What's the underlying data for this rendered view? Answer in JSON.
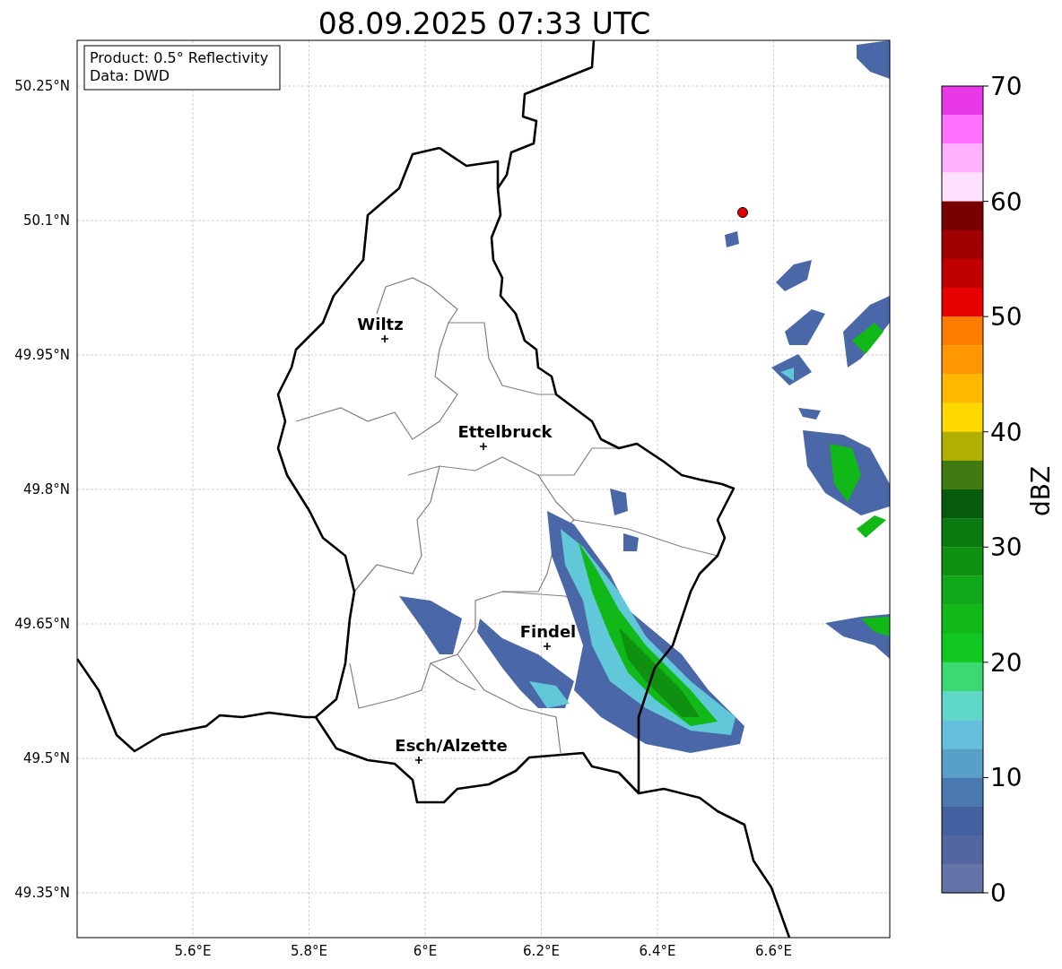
{
  "title": "08.09.2025 07:33 UTC",
  "info_box": {
    "lines": [
      "Product: 0.5° Reflectivity",
      "Data: DWD"
    ]
  },
  "map": {
    "y_tick_labels": [
      "50.25°N",
      "50.1°N",
      "49.95°N",
      "49.8°N",
      "49.65°N",
      "49.5°N",
      "49.35°N"
    ],
    "x_tick_labels": [
      "5.6°E",
      "5.8°E",
      "6°E",
      "6.2°E",
      "6.4°E",
      "6.6°E"
    ],
    "cities": [
      {
        "name": "Wiltz"
      },
      {
        "name": "Ettelbruck"
      },
      {
        "name": "Findel"
      },
      {
        "name": "Esch/Alzette"
      }
    ]
  },
  "colorbar": {
    "label": "dBZ",
    "tick_labels": [
      "70",
      "60",
      "50",
      "40",
      "30",
      "20",
      "10",
      "0"
    ],
    "bins": [
      {
        "color": "#e838e8"
      },
      {
        "color": "#ff70ff"
      },
      {
        "color": "#ffb0ff"
      },
      {
        "color": "#ffe0ff"
      },
      {
        "color": "#780000"
      },
      {
        "color": "#a00000"
      },
      {
        "color": "#c00000"
      },
      {
        "color": "#e60000"
      },
      {
        "color": "#ff7c00"
      },
      {
        "color": "#ff9800"
      },
      {
        "color": "#ffb800"
      },
      {
        "color": "#ffd800"
      },
      {
        "color": "#b0b000"
      },
      {
        "color": "#407a10"
      },
      {
        "color": "#065c0a"
      },
      {
        "color": "#0a7a10"
      },
      {
        "color": "#109010"
      },
      {
        "color": "#10a818"
      },
      {
        "color": "#10b818"
      },
      {
        "color": "#10c820"
      },
      {
        "color": "#3cd870"
      },
      {
        "color": "#60d8c8"
      },
      {
        "color": "#64c0dc"
      },
      {
        "color": "#58a0c8"
      },
      {
        "color": "#4a78b0"
      },
      {
        "color": "#4460a0"
      },
      {
        "color": "#5466a0"
      },
      {
        "color": "#6474a8"
      }
    ]
  }
}
